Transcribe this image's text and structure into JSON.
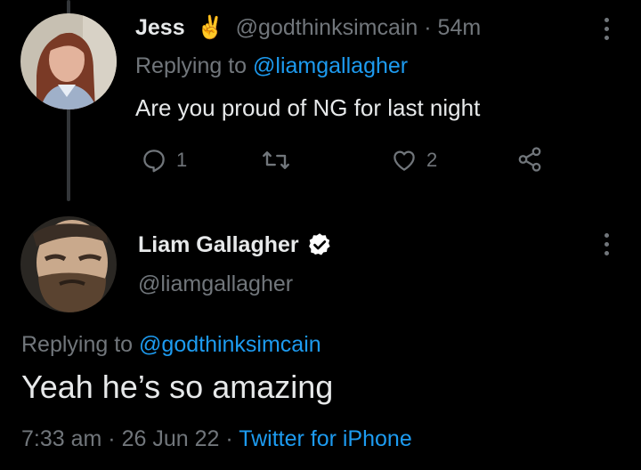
{
  "tweet1": {
    "name": "Jess",
    "emoji": "✌️",
    "handle": "@godthinksimcain",
    "separator": "·",
    "time": "54m",
    "replying_prefix": "Replying to",
    "replying_handle": "@liamgallagher",
    "text": "Are you proud of NG for last night",
    "reply_count": "1",
    "like_count": "2"
  },
  "tweet2": {
    "name": "Liam Gallagher",
    "handle": "@liamgallagher",
    "replying_prefix": "Replying to",
    "replying_handle": "@godthinksimcain",
    "text": "Yeah he’s so amazing",
    "time": "7:33 am",
    "separator": "·",
    "date": "26 Jun 22",
    "separator2": "·",
    "source": "Twitter for iPhone"
  },
  "colors": {
    "background": "#000000",
    "text": "#e7e9ea",
    "muted": "#71767b",
    "link": "#1d9bf0",
    "verified": "#ffffff"
  }
}
